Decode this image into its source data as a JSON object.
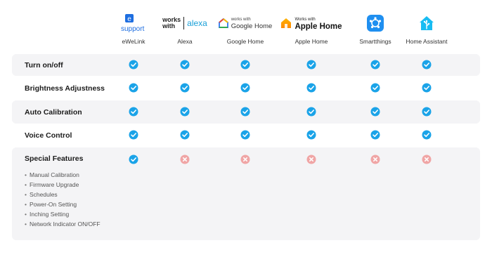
{
  "platforms": [
    {
      "name": "eWeLink",
      "logo_text": [
        "e",
        "support"
      ],
      "icon": "esupport-logo-icon"
    },
    {
      "name": "Alexa",
      "logo_text": [
        "works",
        "with",
        "alexa"
      ],
      "icon": "alexa-logo-icon"
    },
    {
      "name": "Google Home",
      "logo_text": [
        "works with",
        "Google Home"
      ],
      "icon": "google-home-logo-icon"
    },
    {
      "name": "Apple Home",
      "logo_text": [
        "Works with",
        "Apple Home"
      ],
      "icon": "apple-home-logo-icon"
    },
    {
      "name": "Smartthings",
      "icon": "smartthings-logo-icon"
    },
    {
      "name": "Home Assistant",
      "icon": "home-assistant-logo-icon"
    }
  ],
  "rows": [
    {
      "label": "Turn on/off",
      "support": [
        true,
        true,
        true,
        true,
        true,
        true
      ]
    },
    {
      "label": "Brightness Adjustness",
      "support": [
        true,
        true,
        true,
        true,
        true,
        true
      ]
    },
    {
      "label": "Auto Calibration",
      "support": [
        true,
        true,
        true,
        true,
        true,
        true
      ]
    },
    {
      "label": "Voice Control",
      "support": [
        true,
        true,
        true,
        true,
        true,
        true
      ]
    },
    {
      "label": "Special Features",
      "support": [
        true,
        false,
        false,
        false,
        false,
        false
      ],
      "features": [
        "Manual Calibration",
        "Firmware Upgrade",
        "Schedules",
        "Power-On Setting",
        "Inching Setting",
        "Network Indicator ON/OFF"
      ]
    }
  ],
  "colors": {
    "check": "#1aa3e8",
    "cross": "#f0a5a5",
    "row_bg": "#f4f4f6"
  }
}
